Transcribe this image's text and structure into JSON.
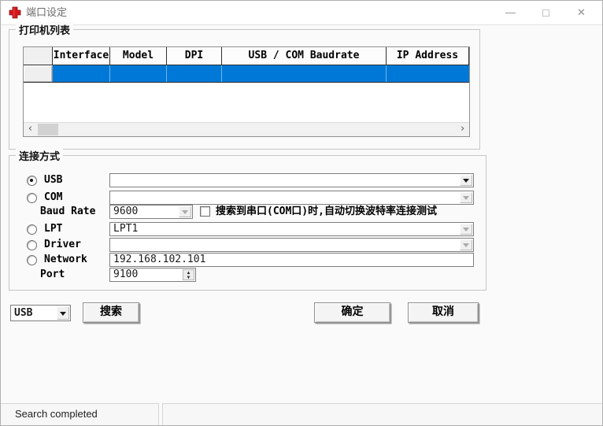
{
  "window": {
    "title": "端口设定",
    "minimize_glyph": "—",
    "maximize_glyph": "□",
    "close_glyph": "✕"
  },
  "printer_list": {
    "group_label": "打印机列表",
    "columns": [
      "",
      "Interface",
      "Model",
      "DPI",
      "USB / COM Baudrate",
      "IP Address"
    ],
    "rows": [
      {
        "selected": true,
        "cells": [
          "",
          "",
          "",
          "",
          ""
        ]
      }
    ],
    "scrollbar": {
      "left_glyph": "‹",
      "right_glyph": "›"
    }
  },
  "connection": {
    "group_label": "连接方式",
    "usb": {
      "label": "USB",
      "selected": true,
      "value": ""
    },
    "com": {
      "label": "COM",
      "selected": false,
      "value": ""
    },
    "baud_rate": {
      "label": "Baud Rate",
      "value": "9600"
    },
    "auto_baud_checkbox": {
      "checked": false,
      "label": "搜索到串口(COM口)时,自动切换波特率连接测试"
    },
    "lpt": {
      "label": "LPT",
      "selected": false,
      "value": "LPT1"
    },
    "driver": {
      "label": "Driver",
      "selected": false,
      "value": ""
    },
    "network": {
      "label": "Network",
      "selected": false,
      "value": "192.168.102.101"
    },
    "port": {
      "label": "Port",
      "value": "9100",
      "up_glyph": "▲",
      "down_glyph": "▼"
    }
  },
  "footer": {
    "interface_combo_value": "USB",
    "search_button": "搜索",
    "ok_button": "确定",
    "cancel_button": "取消"
  },
  "status_bar": {
    "message": "Search completed"
  },
  "colors": {
    "selection_blue": "#0078d7",
    "app_icon_red": "#d2151c"
  }
}
